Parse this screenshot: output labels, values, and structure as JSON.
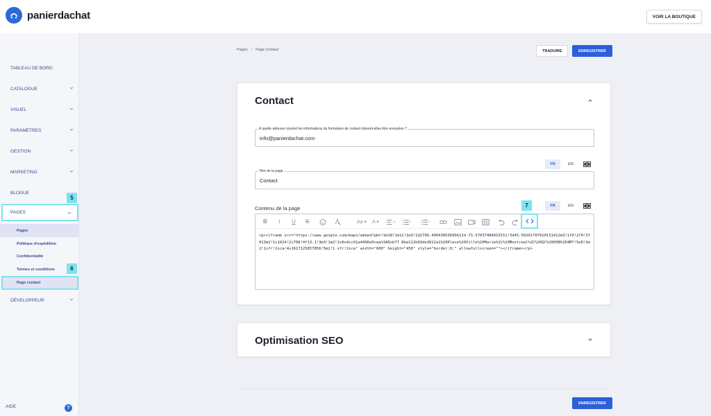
{
  "brand": {
    "name": "panierdachat",
    "color": "#2c6ad9"
  },
  "header": {
    "view_shop": "VOIR LA BOUTIQUE"
  },
  "sidebar": {
    "items": [
      {
        "label": "TABLEAU DE BORD"
      },
      {
        "label": "CATALOGUE"
      },
      {
        "label": "VISUEL"
      },
      {
        "label": "PARAMÈTRES"
      },
      {
        "label": "GESTION"
      },
      {
        "label": "MARKETING"
      },
      {
        "label": "BLOGUE"
      },
      {
        "label": "PAGES"
      },
      {
        "label": "DÉVELOPPEUR"
      }
    ],
    "subitems": [
      {
        "label": "Pages"
      },
      {
        "label": "Politique d'expédition"
      },
      {
        "label": "Confidentialité"
      },
      {
        "label": "Termes et conditions"
      },
      {
        "label": "Page contact"
      }
    ],
    "help": "AIDE",
    "help_icon": "?"
  },
  "badges": {
    "pages": "5",
    "page_contact": "6",
    "code_view": "7",
    "color": "#7de3ef"
  },
  "breadcrumb": {
    "root": "Pages",
    "separator": "/",
    "current": "Page Contact"
  },
  "actions": {
    "translate": "TRADUIRE",
    "save": "ENREGISTRER"
  },
  "contact_card": {
    "title": "Contact",
    "email_label": "À quelle adresse courriel les informations du formulaire de contact doivent-elles être envoyées ?",
    "email_value": "info@panierdachat.com",
    "page_title_label": "Titre de la page",
    "page_title_value": "Contact",
    "content_label": "Contenu de la page",
    "languages": [
      "FR",
      "EN"
    ],
    "active_language": "FR",
    "html_content": "<p><iframe src=\"https://www.google.com/maps/embed?pb=!1m18!1m12!1m3!1d2796.40043853696612d-73.57037484019151!3d45.50201707910131412m3!1f0!2f0!3f013m2!1i1024!2i768!4f13.1!3m3!1m2!1s0x4cc91a4496e0cea%3A0xb77\nRba112b69de3812a1%20Place%20Ville%20Marie%2C%20Montreal%2C%20QC%20H3B%204M7!5e0!3m2!1sfr!2sca!4v1617125857856!5m2!1\nsfr!2sca\" width=\"600\" height=\"450\" style=\"border:0;\" allowfullscreen=\"\"></iframe></p>"
  },
  "seo_card": {
    "title": "Optimisation SEO"
  },
  "accent_color": "#2c5fd8"
}
